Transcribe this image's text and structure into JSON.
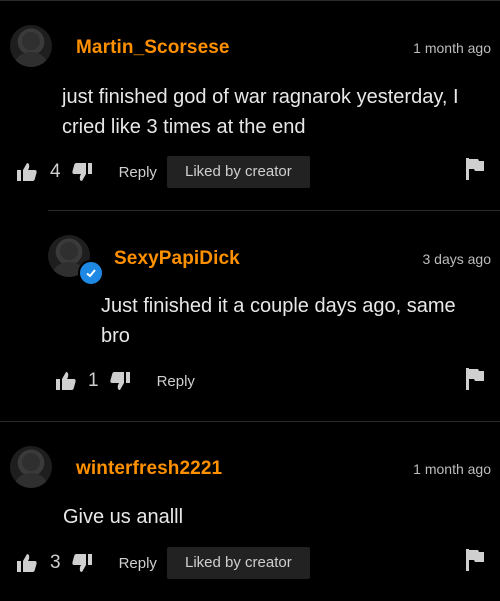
{
  "comments": [
    {
      "username": "Martin_Scorsese",
      "date": "1 month ago",
      "lines": [
        "just finished god of war ragnarok yesterday, I",
        "cried like 3 times at the end"
      ],
      "likes": "4",
      "reply_label": "Reply",
      "liked_by_creator": "Liked by creator"
    },
    {
      "username": "SexyPapiDick",
      "date": "3 days ago",
      "lines": [
        "Just finished it a couple days ago, same",
        "bro"
      ],
      "likes": "1",
      "reply_label": "Reply",
      "verified": true
    },
    {
      "username": "winterfresh2221",
      "date": "1 month ago",
      "lines": [
        "Give us analll"
      ],
      "likes": "3",
      "reply_label": "Reply",
      "liked_by_creator": "Liked by creator"
    }
  ],
  "colors": {
    "username": "#ff9000",
    "badge": "#1e88e5",
    "background": "#000000"
  },
  "icons": [
    "thumbs-up-icon",
    "thumbs-down-icon",
    "flag-icon",
    "verified-check-icon"
  ]
}
